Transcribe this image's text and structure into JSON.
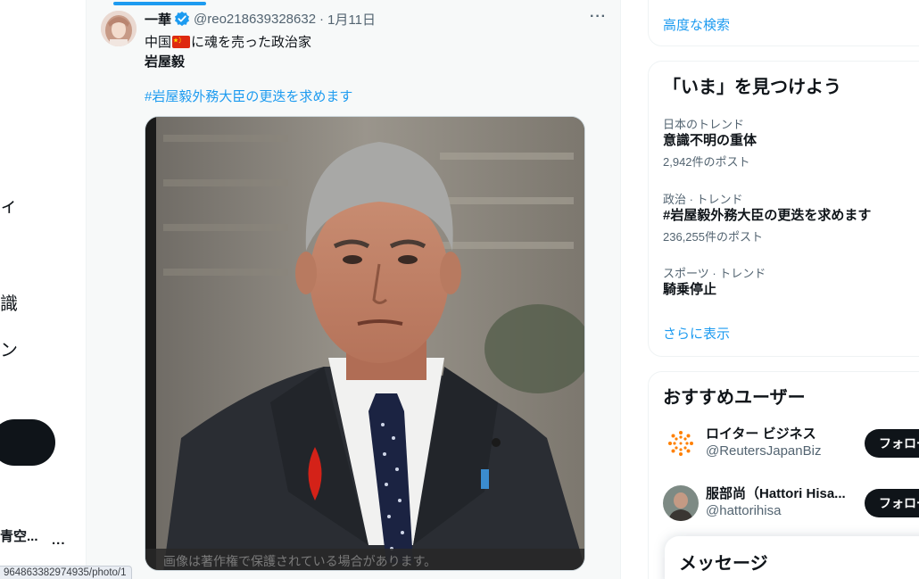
{
  "left_nav": {
    "fragments": [
      "ィ",
      "識",
      "ン"
    ],
    "account_name": "青空...",
    "account_more": "..."
  },
  "tweet": {
    "author_name": "一華",
    "author_handle": "@reo218639328632",
    "separator": "·",
    "date": "1月11日",
    "more": "···",
    "line1_before": "中国",
    "line1_after": "に魂を売った政治家",
    "line2": "岩屋毅",
    "hashtag": "#岩屋毅外務大臣の更迭を求めます",
    "media_note": "画像は著作権で保護されている場合があります。"
  },
  "status_bar": {
    "url": "964863382974935/photo/1"
  },
  "sidebar": {
    "advanced_search": "高度な検索",
    "trends_title": "「いま」を見つけよう",
    "trends": [
      {
        "context": "日本のトレンド",
        "name": "意識不明の重体",
        "count": "2,942件のポスト"
      },
      {
        "context": "政治 · トレンド",
        "name": "#岩屋毅外務大臣の更迭を求めます",
        "count": "236,255件のポスト"
      },
      {
        "context": "スポーツ · トレンド",
        "name": "騎乗停止",
        "count": ""
      }
    ],
    "show_more": "さらに表示",
    "who_title": "おすすめユーザー",
    "users": [
      {
        "name": "ロイター ビジネス",
        "handle": "@ReutersJapanBiz",
        "follow": "フォロー"
      },
      {
        "name": "服部尚（Hattori Hisa...",
        "handle": "@hattorihisa",
        "follow": "フォロー"
      }
    ],
    "messages_title": "メッセージ"
  },
  "colors": {
    "accent": "#1d9bf0",
    "text": "#0f1419",
    "muted": "#536471",
    "button": "#0f1419"
  },
  "icons": [
    "verified-badge-icon",
    "china-flag-icon",
    "more-icon",
    "reuters-logo-icon"
  ]
}
